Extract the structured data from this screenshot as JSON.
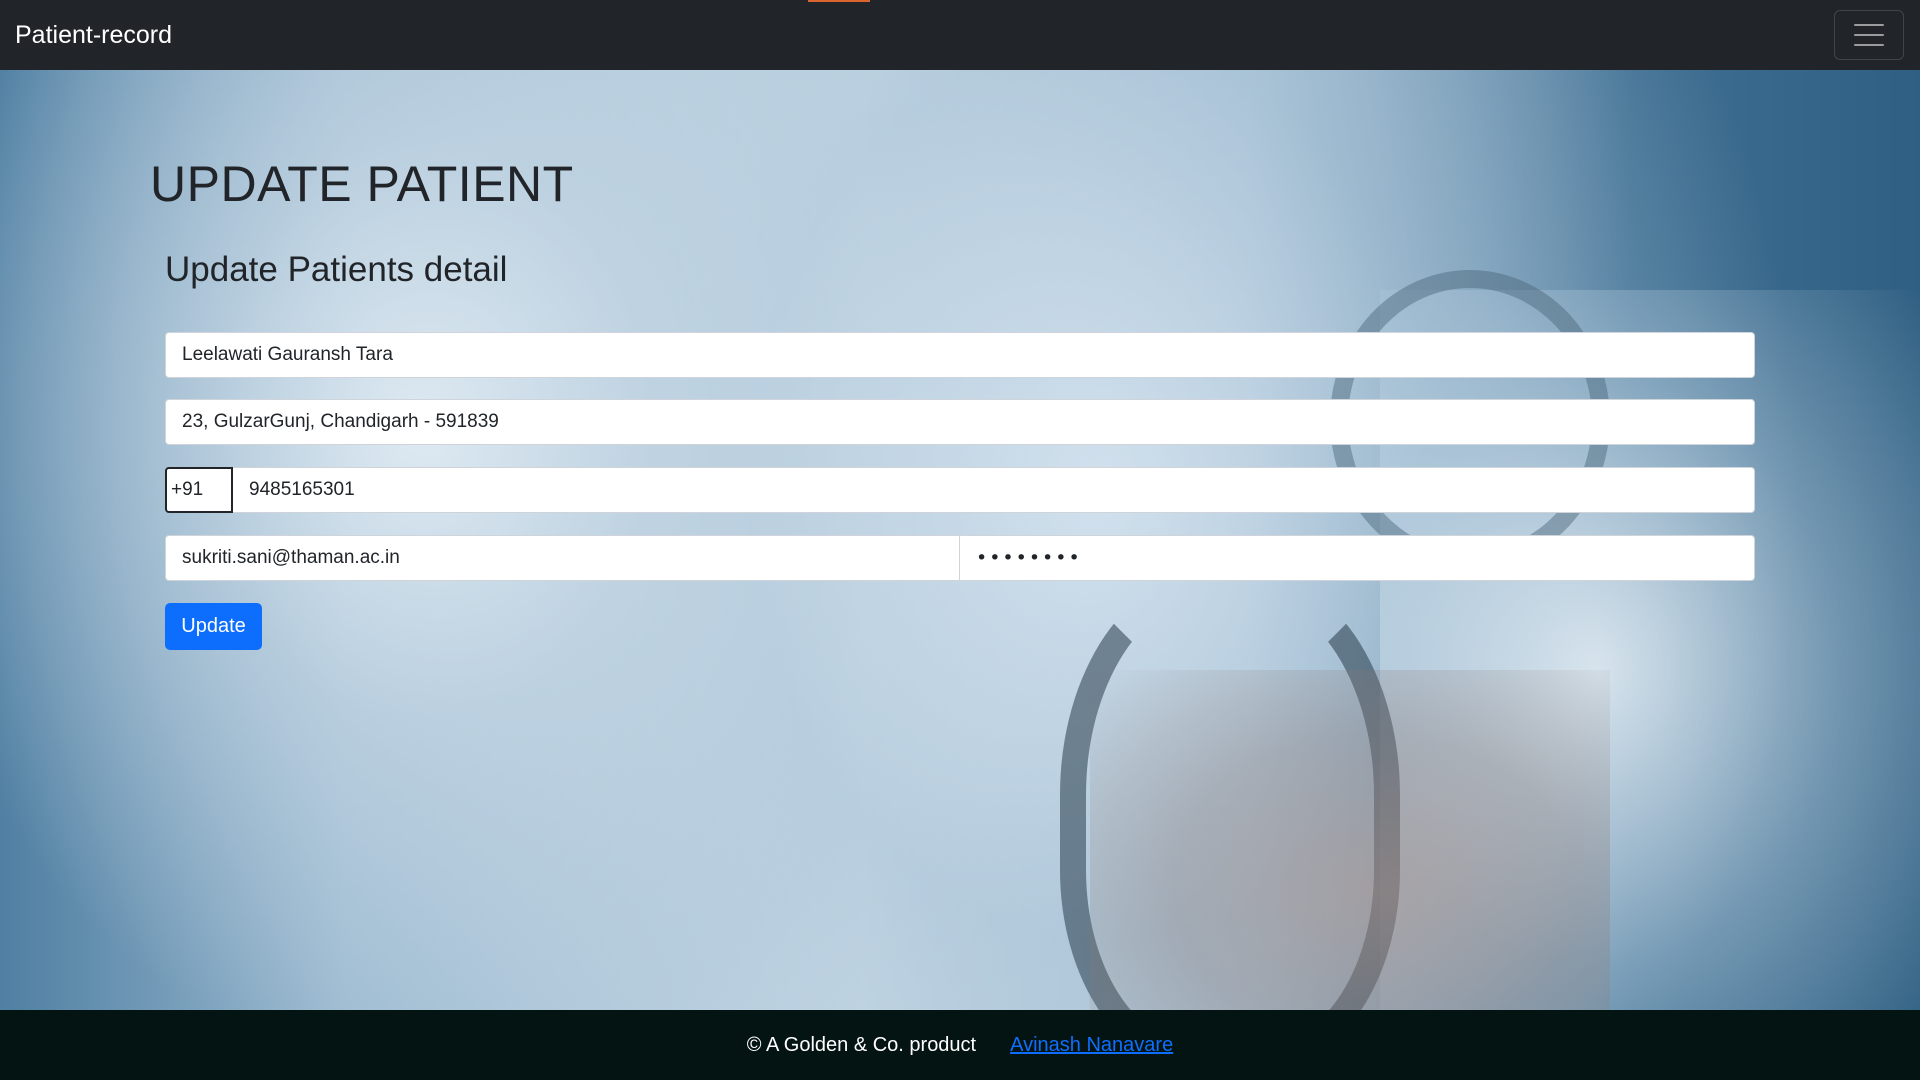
{
  "navbar": {
    "brand": "Patient-record",
    "toggle_icon": "hamburger-icon"
  },
  "page": {
    "title": "UPDATE PATIENT",
    "section_title": "Update Patients detail"
  },
  "form": {
    "name": "Leelawati Gauransh Tara",
    "address": "23, GulzarGunj, Chandigarh - 591839",
    "phone_prefix": "+91",
    "phone": "9485165301",
    "email": "sukriti.sani@thaman.ac.in",
    "password": "••••••••",
    "submit_label": "Update"
  },
  "footer": {
    "copyright": "© A Golden & Co. product",
    "author_link": "Avinash Nanavare"
  },
  "colors": {
    "navbar_bg": "#212529",
    "primary": "#0d6efd",
    "footer_bg": "#041412"
  }
}
